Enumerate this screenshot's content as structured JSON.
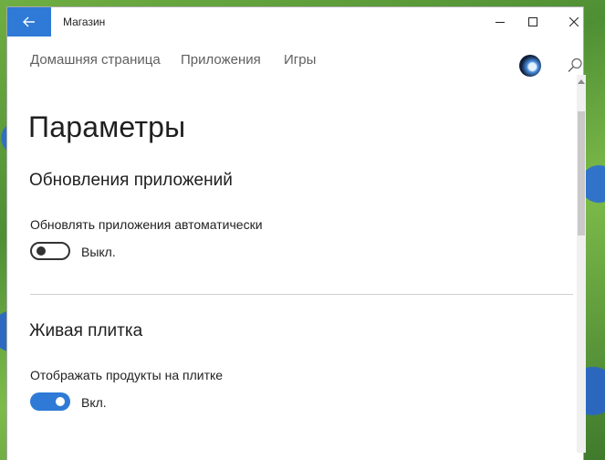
{
  "window": {
    "title": "Магазин"
  },
  "nav": {
    "items": [
      "Домашняя страница",
      "Приложения",
      "Игры"
    ]
  },
  "page": {
    "title": "Параметры"
  },
  "sections": [
    {
      "title": "Обновления приложений",
      "setting_label": "Обновлять приложения автоматически",
      "toggle_state": "Выкл.",
      "toggle_on": false
    },
    {
      "title": "Живая плитка",
      "setting_label": "Отображать продукты на плитке",
      "toggle_state": "Вкл.",
      "toggle_on": true
    }
  ],
  "icons": {
    "back": "arrow-left-icon",
    "minimize": "minimize-icon",
    "maximize": "maximize-icon",
    "close": "close-icon",
    "search": "search-icon",
    "avatar": "user-avatar"
  },
  "colors": {
    "accent": "#2e7ad6"
  }
}
